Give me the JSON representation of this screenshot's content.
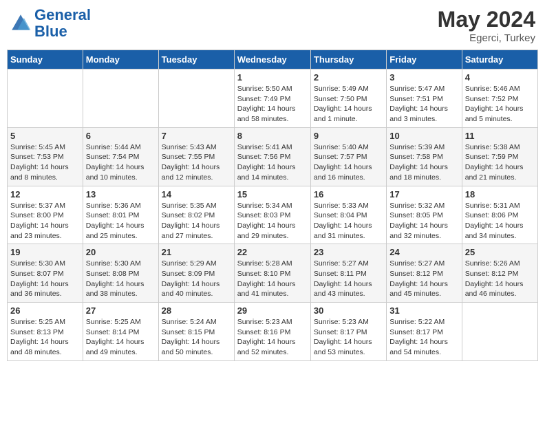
{
  "header": {
    "logo_line1": "General",
    "logo_line2": "Blue",
    "month_year": "May 2024",
    "location": "Egerci, Turkey"
  },
  "days_of_week": [
    "Sunday",
    "Monday",
    "Tuesday",
    "Wednesday",
    "Thursday",
    "Friday",
    "Saturday"
  ],
  "weeks": [
    [
      {
        "day": "",
        "info": ""
      },
      {
        "day": "",
        "info": ""
      },
      {
        "day": "",
        "info": ""
      },
      {
        "day": "1",
        "info": "Sunrise: 5:50 AM\nSunset: 7:49 PM\nDaylight: 14 hours\nand 58 minutes."
      },
      {
        "day": "2",
        "info": "Sunrise: 5:49 AM\nSunset: 7:50 PM\nDaylight: 14 hours\nand 1 minute."
      },
      {
        "day": "3",
        "info": "Sunrise: 5:47 AM\nSunset: 7:51 PM\nDaylight: 14 hours\nand 3 minutes."
      },
      {
        "day": "4",
        "info": "Sunrise: 5:46 AM\nSunset: 7:52 PM\nDaylight: 14 hours\nand 5 minutes."
      }
    ],
    [
      {
        "day": "5",
        "info": "Sunrise: 5:45 AM\nSunset: 7:53 PM\nDaylight: 14 hours\nand 8 minutes."
      },
      {
        "day": "6",
        "info": "Sunrise: 5:44 AM\nSunset: 7:54 PM\nDaylight: 14 hours\nand 10 minutes."
      },
      {
        "day": "7",
        "info": "Sunrise: 5:43 AM\nSunset: 7:55 PM\nDaylight: 14 hours\nand 12 minutes."
      },
      {
        "day": "8",
        "info": "Sunrise: 5:41 AM\nSunset: 7:56 PM\nDaylight: 14 hours\nand 14 minutes."
      },
      {
        "day": "9",
        "info": "Sunrise: 5:40 AM\nSunset: 7:57 PM\nDaylight: 14 hours\nand 16 minutes."
      },
      {
        "day": "10",
        "info": "Sunrise: 5:39 AM\nSunset: 7:58 PM\nDaylight: 14 hours\nand 18 minutes."
      },
      {
        "day": "11",
        "info": "Sunrise: 5:38 AM\nSunset: 7:59 PM\nDaylight: 14 hours\nand 21 minutes."
      }
    ],
    [
      {
        "day": "12",
        "info": "Sunrise: 5:37 AM\nSunset: 8:00 PM\nDaylight: 14 hours\nand 23 minutes."
      },
      {
        "day": "13",
        "info": "Sunrise: 5:36 AM\nSunset: 8:01 PM\nDaylight: 14 hours\nand 25 minutes."
      },
      {
        "day": "14",
        "info": "Sunrise: 5:35 AM\nSunset: 8:02 PM\nDaylight: 14 hours\nand 27 minutes."
      },
      {
        "day": "15",
        "info": "Sunrise: 5:34 AM\nSunset: 8:03 PM\nDaylight: 14 hours\nand 29 minutes."
      },
      {
        "day": "16",
        "info": "Sunrise: 5:33 AM\nSunset: 8:04 PM\nDaylight: 14 hours\nand 31 minutes."
      },
      {
        "day": "17",
        "info": "Sunrise: 5:32 AM\nSunset: 8:05 PM\nDaylight: 14 hours\nand 32 minutes."
      },
      {
        "day": "18",
        "info": "Sunrise: 5:31 AM\nSunset: 8:06 PM\nDaylight: 14 hours\nand 34 minutes."
      }
    ],
    [
      {
        "day": "19",
        "info": "Sunrise: 5:30 AM\nSunset: 8:07 PM\nDaylight: 14 hours\nand 36 minutes."
      },
      {
        "day": "20",
        "info": "Sunrise: 5:30 AM\nSunset: 8:08 PM\nDaylight: 14 hours\nand 38 minutes."
      },
      {
        "day": "21",
        "info": "Sunrise: 5:29 AM\nSunset: 8:09 PM\nDaylight: 14 hours\nand 40 minutes."
      },
      {
        "day": "22",
        "info": "Sunrise: 5:28 AM\nSunset: 8:10 PM\nDaylight: 14 hours\nand 41 minutes."
      },
      {
        "day": "23",
        "info": "Sunrise: 5:27 AM\nSunset: 8:11 PM\nDaylight: 14 hours\nand 43 minutes."
      },
      {
        "day": "24",
        "info": "Sunrise: 5:27 AM\nSunset: 8:12 PM\nDaylight: 14 hours\nand 45 minutes."
      },
      {
        "day": "25",
        "info": "Sunrise: 5:26 AM\nSunset: 8:12 PM\nDaylight: 14 hours\nand 46 minutes."
      }
    ],
    [
      {
        "day": "26",
        "info": "Sunrise: 5:25 AM\nSunset: 8:13 PM\nDaylight: 14 hours\nand 48 minutes."
      },
      {
        "day": "27",
        "info": "Sunrise: 5:25 AM\nSunset: 8:14 PM\nDaylight: 14 hours\nand 49 minutes."
      },
      {
        "day": "28",
        "info": "Sunrise: 5:24 AM\nSunset: 8:15 PM\nDaylight: 14 hours\nand 50 minutes."
      },
      {
        "day": "29",
        "info": "Sunrise: 5:23 AM\nSunset: 8:16 PM\nDaylight: 14 hours\nand 52 minutes."
      },
      {
        "day": "30",
        "info": "Sunrise: 5:23 AM\nSunset: 8:17 PM\nDaylight: 14 hours\nand 53 minutes."
      },
      {
        "day": "31",
        "info": "Sunrise: 5:22 AM\nSunset: 8:17 PM\nDaylight: 14 hours\nand 54 minutes."
      },
      {
        "day": "",
        "info": ""
      }
    ]
  ]
}
